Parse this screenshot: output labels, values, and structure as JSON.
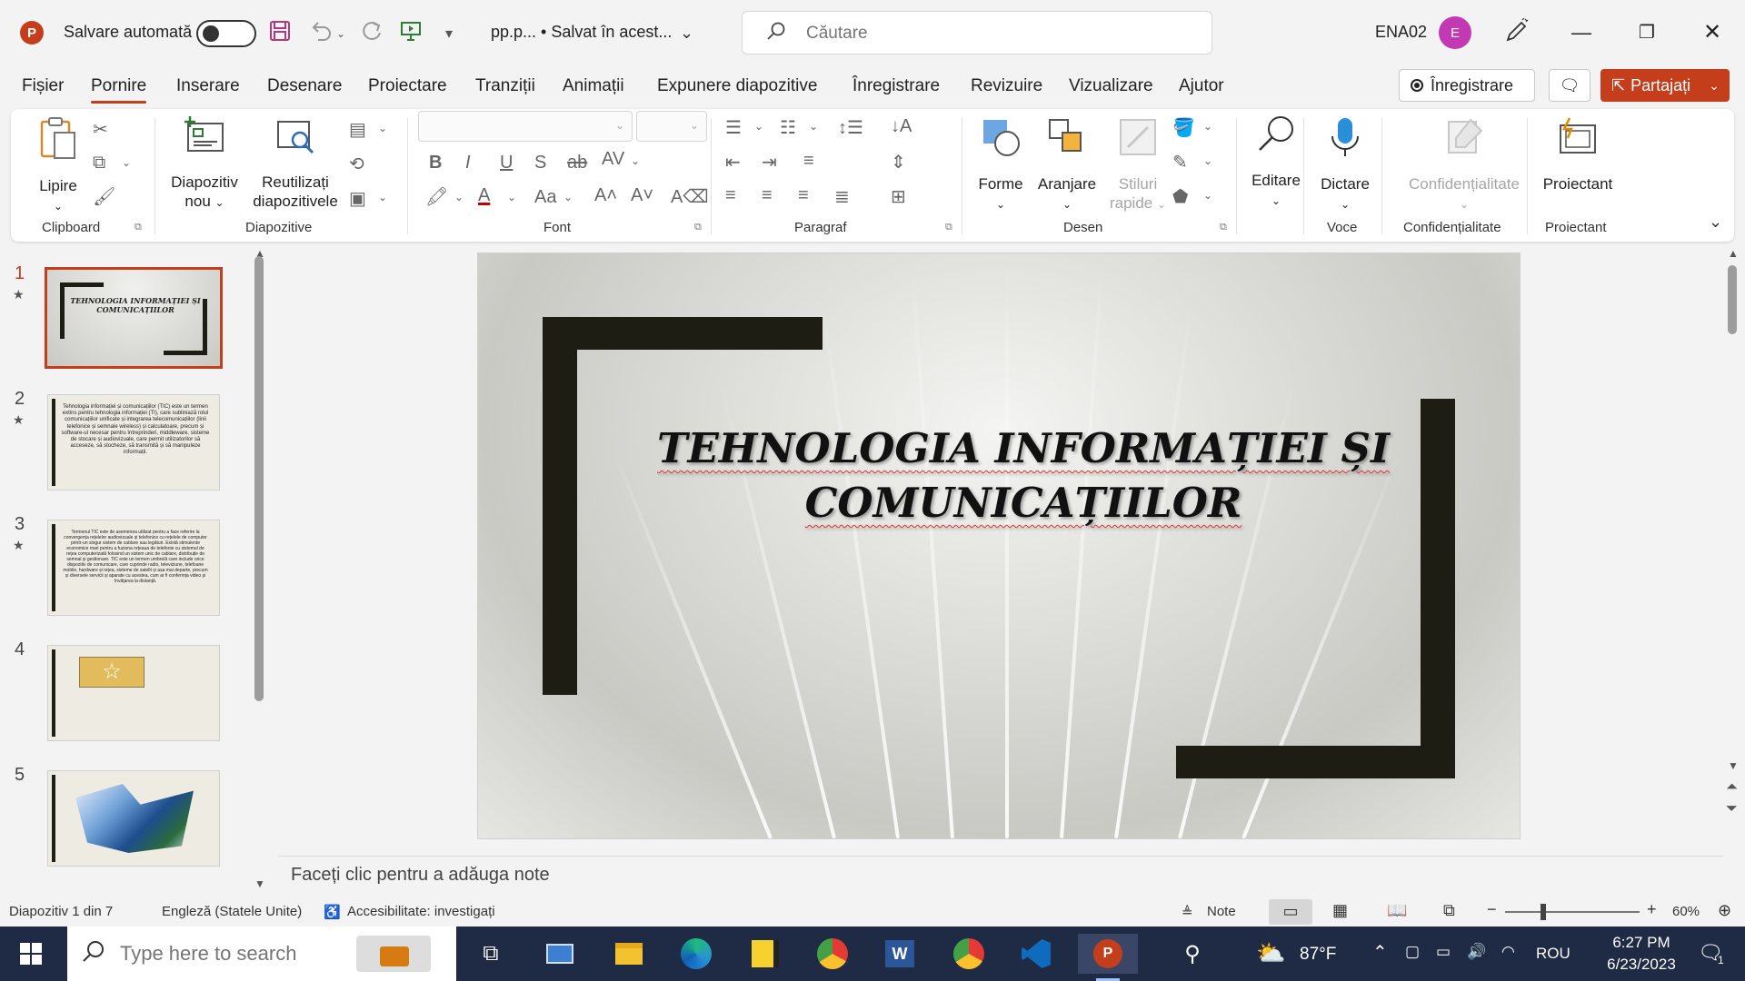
{
  "titlebar": {
    "app_icon_letter": "P",
    "autosave_label": "Salvare automată",
    "filename": "pp.p...  • Salvat în acest...",
    "search_placeholder": "Căutare",
    "user_name": "ENA02",
    "avatar_letter": "E",
    "icons": [
      "save-icon",
      "undo-icon",
      "redo-icon",
      "present-from-start-icon",
      "customize-icon",
      "pen-icon",
      "minimize-icon",
      "restore-icon",
      "close-icon"
    ]
  },
  "tabs": [
    "Fișier",
    "Pornire",
    "Inserare",
    "Desenare",
    "Proiectare",
    "Tranziții",
    "Animații",
    "Expunere diapozitive",
    "Înregistrare",
    "Revizuire",
    "Vizualizare",
    "Ajutor"
  ],
  "active_tab": "Pornire",
  "actions": {
    "record_label": "Înregistrare",
    "share_label": "Partajați"
  },
  "ribbon": {
    "groups": {
      "clipboard": "Clipboard",
      "slides": "Diapozitive",
      "font": "Font",
      "paragraph": "Paragraf",
      "drawing": "Desen",
      "voice": "Voce",
      "sensitivity": "Confidențialitate",
      "designer": "Proiectant"
    },
    "buttons": {
      "paste": "Lipire",
      "new_slide_1": "Diapozitiv",
      "new_slide_2": "nou",
      "reuse_1": "Reutilizați",
      "reuse_2": "diapozitivele",
      "shapes": "Forme",
      "arrange": "Aranjare",
      "quick_styles_1": "Stiluri",
      "quick_styles_2": "rapide",
      "editing": "Editare",
      "dictate": "Dictare",
      "sensitivity": "Confidențialitate",
      "designer": "Proiectant"
    }
  },
  "slides_panel": {
    "slides": [
      {
        "number": "1",
        "text": "TEHNOLOGIA INFORMAȚIEI ȘI COMUNICAȚIILOR"
      },
      {
        "number": "2",
        "text": "Tehnologia informației și comunicațiilor (TIC) este un termen extins pentru tehnologia informației (TI), care subliniază rolul comunicațiilor unificate și integrarea telecomunicațiilor (linii telefonice și semnale wireless) și calculatoare, precum și software-ul necesar pentru întreprinderi, middleware, sisteme de stocare și audiovizuale, care permit utilizatorilor să acceseze, să stocheze, să transmită și să manipuleze informații."
      },
      {
        "number": "3",
        "text": "Termenul TIC este de asemenea utilizat pentru a face referire la convergența rețelelor audiovizuale și telefonice cu rețelele de computer printr-un singur sistem de cablare sau legături. Există stimulente economice mari pentru a fuziona rețeaua de telefonie cu sistemul de rețea computerizată folosind un sistem unic de cablare, distribuție de semnal și gestionare. TIC este un termen umbrelă care include orice dispozitiv de comunicare, care cuprinde radio, televiziune, telefoane mobile, hardware și rețea, sisteme de satelit și așa mai departe, precum și diversele servicii și aparate cu acestea, cum ar fi conferința video și învățarea la distanță."
      },
      {
        "number": "4",
        "text": ""
      },
      {
        "number": "5",
        "text": ""
      }
    ]
  },
  "slide": {
    "title_line1": "TEHNOLOGIA INFORMAȚIEI ȘI",
    "title_line2": "COMUNICAȚIILOR"
  },
  "notes_placeholder": "Faceți clic pentru a adăuga note",
  "status": {
    "slide_count": "Diapozitiv 1 din 7",
    "language": "Engleză (Statele Unite)",
    "accessibility": "Accesibilitate: investigați",
    "notes": "Note",
    "zoom": "60%"
  },
  "taskbar": {
    "search_placeholder": "Type here to search",
    "weather": "87°F",
    "language": "ROU",
    "time": "6:27 PM",
    "date": "6/23/2023",
    "notification_count": "1"
  },
  "colors": {
    "accent": "#c43e1c",
    "taskbar": "#1f2a44",
    "bracket": "#1d1d14"
  }
}
